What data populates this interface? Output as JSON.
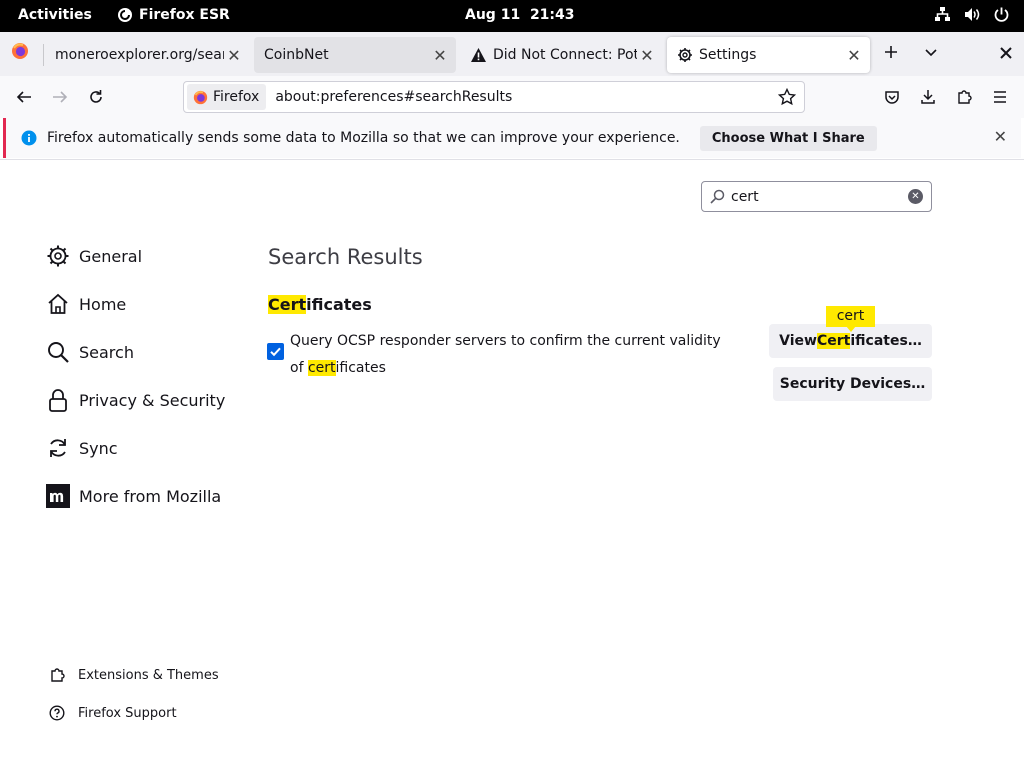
{
  "system_bar": {
    "activities": "Activities",
    "app_name": "Firefox ESR",
    "date": "Aug 11",
    "time": "21:43"
  },
  "tabs": [
    {
      "title": "moneroexplorer.org/search",
      "state": "normal"
    },
    {
      "title": "CoinbNet",
      "state": "hovered"
    },
    {
      "title": "Did Not Connect: Potential Security Issue",
      "state": "normal",
      "icon": "warning-icon"
    },
    {
      "title": "Settings",
      "state": "active",
      "icon": "gear-icon"
    }
  ],
  "urlbar": {
    "identity_label": "Firefox",
    "url": "about:preferences#searchResults"
  },
  "notification": {
    "message": "Firefox automatically sends some data to Mozilla so that we can improve your experience.",
    "button": "Choose What I Share",
    "accent": "#e22850"
  },
  "search": {
    "value": "cert"
  },
  "sidebar": {
    "categories": [
      {
        "label": "General",
        "icon": "gear-icon"
      },
      {
        "label": "Home",
        "icon": "home-icon"
      },
      {
        "label": "Search",
        "icon": "search-icon"
      },
      {
        "label": "Privacy & Security",
        "icon": "lock-icon"
      },
      {
        "label": "Sync",
        "icon": "sync-icon"
      },
      {
        "label": "More from Mozilla",
        "icon": "mozilla-icon"
      }
    ],
    "footer": [
      {
        "label": "Extensions & Themes",
        "icon": "puzzle-icon"
      },
      {
        "label": "Firefox Support",
        "icon": "help-icon"
      }
    ]
  },
  "main": {
    "title": "Search Results",
    "section": {
      "heading_highlight": "Cert",
      "heading_rest": "ificates",
      "ocsp": {
        "checked": true,
        "label_start": "Query OCSP responder servers to confirm the current validity of ",
        "label_highlight": "cert",
        "label_end": "ificates"
      },
      "view_button": {
        "pre": "View ",
        "highlight": "Cert",
        "post": "ificates…"
      },
      "devices_button": "Security Devices…",
      "tooltip": "cert"
    },
    "accent_color": "#0061e0",
    "highlight_color": "#ffe900"
  }
}
